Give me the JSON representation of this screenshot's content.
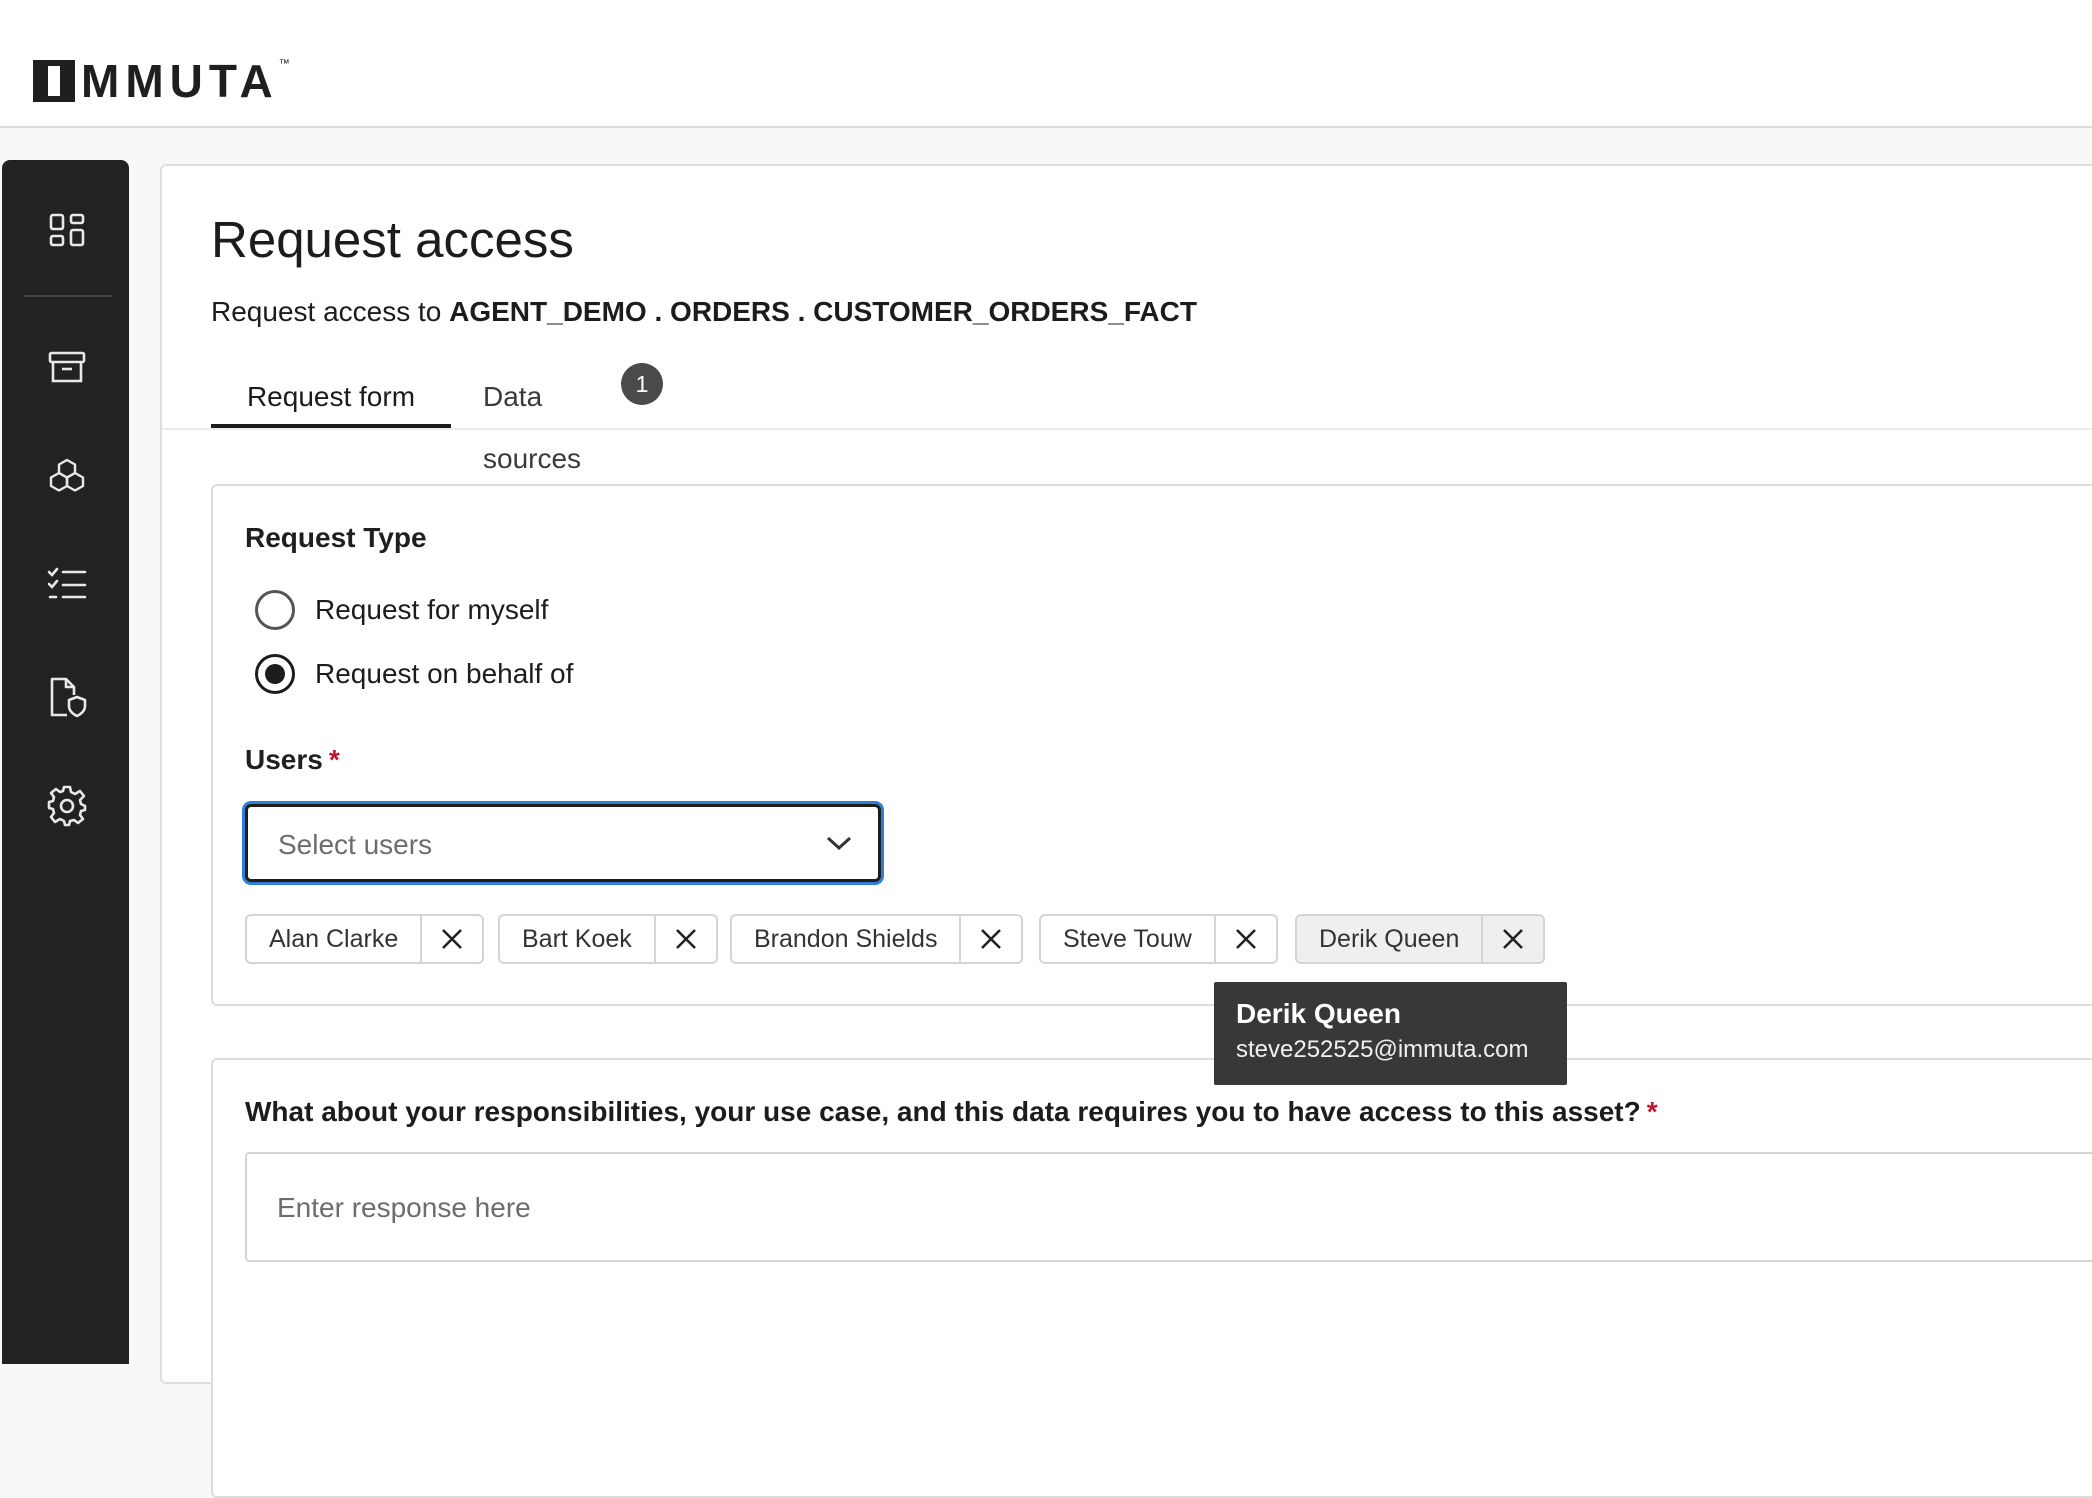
{
  "brand": {
    "logo_text": "MMUTA",
    "tm": "™",
    "full_name": "IMMUTA"
  },
  "sidebar": {
    "items": [
      {
        "name": "dashboard",
        "icon": "dashboard-grid-icon"
      },
      {
        "name": "archive",
        "icon": "archive-box-icon"
      },
      {
        "name": "data-products",
        "icon": "cubes-icon"
      },
      {
        "name": "tasks",
        "icon": "checklist-icon"
      },
      {
        "name": "policies",
        "icon": "document-shield-icon"
      },
      {
        "name": "settings",
        "icon": "gear-icon"
      }
    ]
  },
  "page": {
    "title": "Request access",
    "subtitle_prefix": "Request access to",
    "asset_path": "AGENT_DEMO . ORDERS . CUSTOMER_ORDERS_FACT"
  },
  "tabs": [
    {
      "label": "Request form",
      "active": true
    },
    {
      "label": "Data sources",
      "badge": "1"
    }
  ],
  "request_type": {
    "title": "Request Type",
    "options": [
      {
        "label": "Request for myself",
        "selected": false
      },
      {
        "label": "Request on behalf of",
        "selected": true
      }
    ]
  },
  "users": {
    "label": "Users",
    "required_mark": "*",
    "placeholder": "Select users",
    "selected": [
      "Alan Clarke",
      "Bart Koek",
      "Brandon Shields",
      "Steve Touw",
      "Derik Queen"
    ]
  },
  "tooltip": {
    "name": "Derik Queen",
    "email": "steve252525@immuta.com"
  },
  "question": {
    "label": "What about your responsibilities, your use case, and this data requires you to have access to this asset?",
    "required_mark": "*",
    "placeholder": "Enter response here"
  },
  "colors": {
    "sidebar_bg": "#222222",
    "focus_ring": "#2f7fd6",
    "required": "#c0152f",
    "tooltip_bg": "#383838"
  }
}
